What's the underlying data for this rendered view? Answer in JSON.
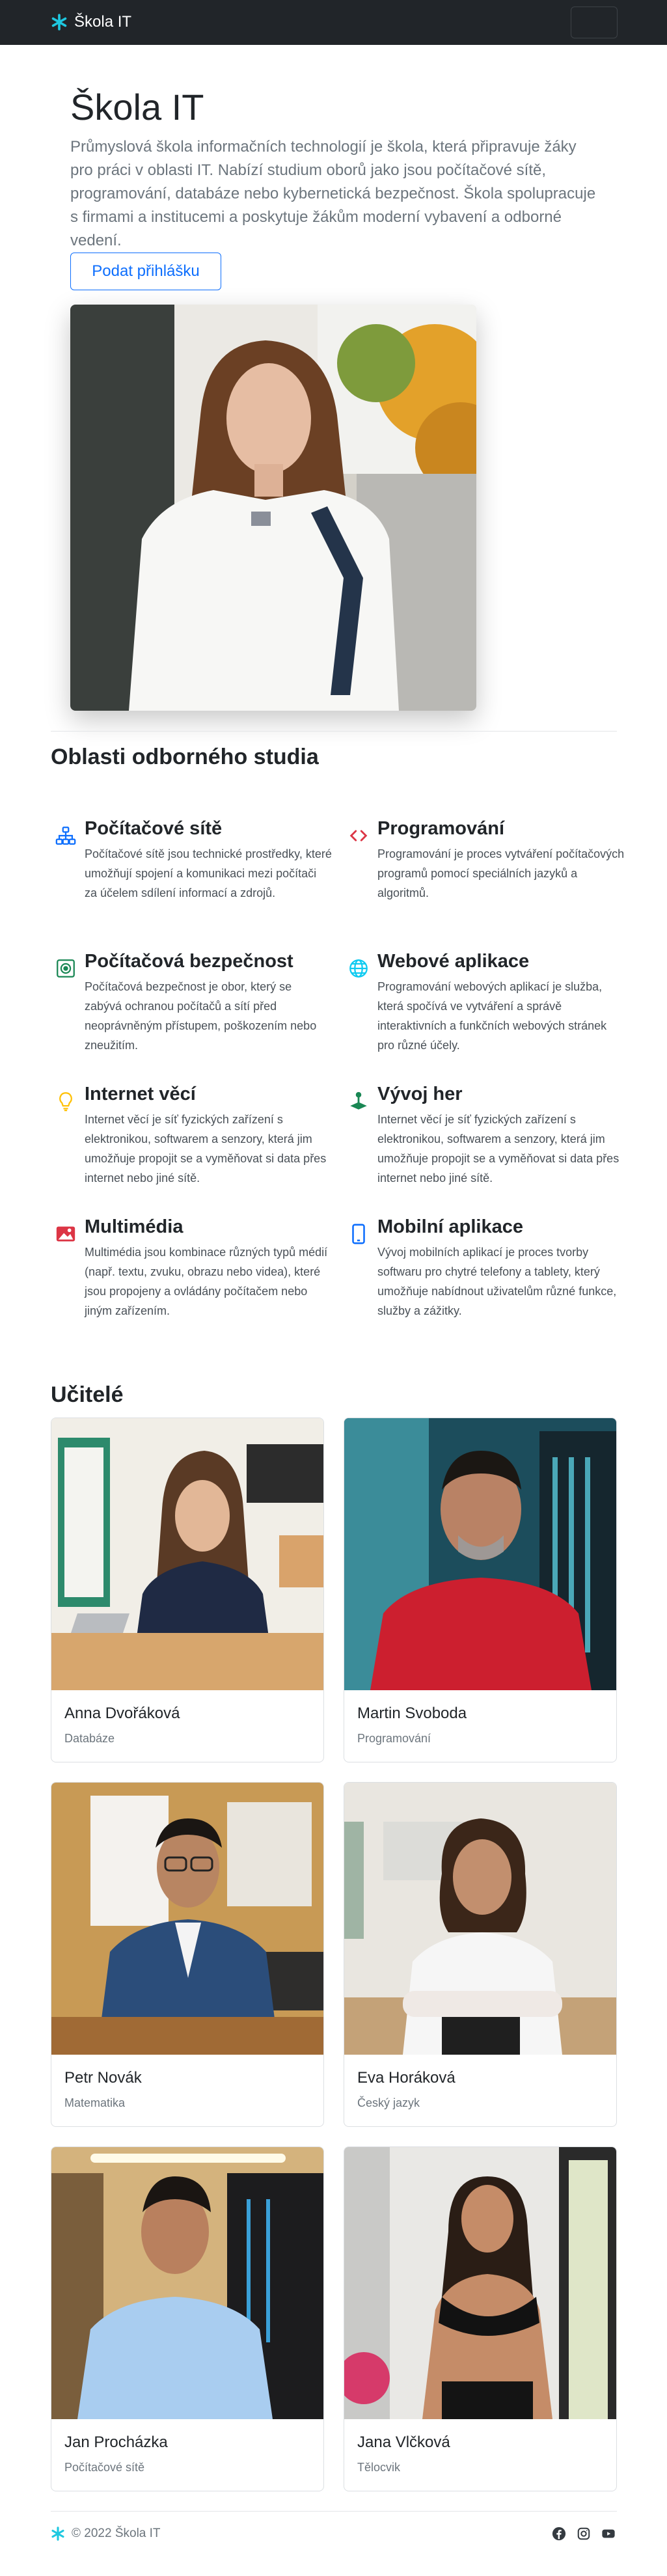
{
  "navbar": {
    "brand": "Škola IT",
    "brand_icon": "asterisk-icon",
    "toggler_icon": "menu-toggle"
  },
  "hero": {
    "title": "Škola IT",
    "lead": "Průmyslová škola informačních technologií je škola, která připravuje žáky pro práci v oblasti IT. Nabízí studium oborů jako jsou počítačové sítě, programování, databáze nebo kybernetická bezpečnost. Škola spolupracuje s firmami a institucemi a poskytuje žákům moderní vybavení a odborné vedení.",
    "button": "Podat přihlášku"
  },
  "features_title": "Oblasti odborného studia",
  "features": [
    {
      "title": "Počítačové sítě",
      "icon": "network-icon",
      "text": "Počítačové sítě jsou technické prostředky, které umožňují spojení a komunikaci mezi počítači za účelem sdílení informací a zdrojů."
    },
    {
      "title": "Programování",
      "icon": "code-icon",
      "text": "Programování je proces vytváření počítačových programů pomocí speciálních jazyků a algoritmů."
    },
    {
      "title": "Počítačová bezpečnost",
      "icon": "shield-icon",
      "text": "Počítačová bezpečnost je obor, který se zabývá ochranou počítačů a sítí před neoprávněným přístupem, poškozením nebo zneužitím."
    },
    {
      "title": "Webové aplikace",
      "icon": "globe-icon",
      "text": "Programování webových aplikací je služba, která spočívá ve vytváření a správě interaktivních a funkčních webových stránek pro různé účely."
    },
    {
      "title": "Internet věcí",
      "icon": "lightbulb-icon",
      "text": "Internet věcí je síť fyzických zařízení s elektronikou, softwarem a senzory, která jim umožňuje propojit se a vyměňovat si data přes internet nebo jiné sítě."
    },
    {
      "title": "Vývoj her",
      "icon": "controller-icon",
      "text": "Internet věcí je síť fyzických zařízení s elektronikou, softwarem a senzory, která jim umožňuje propojit se a vyměňovat si data přes internet nebo jiné sítě."
    },
    {
      "title": "Multimédia",
      "icon": "image-icon",
      "text": "Multimédia jsou kombinace různých typů médií (např. textu, zvuku, obrazu nebo videa), které jsou propojeny a ovládány počítačem nebo jiným zařízením."
    },
    {
      "title": "Mobilní aplikace",
      "icon": "phone-icon",
      "text": "Vývoj mobilních aplikací je proces tvorby softwaru pro chytré telefony a tablety, který umožňuje nabídnout uživatelům různé funkce, služby a zážitky."
    }
  ],
  "teachers_title": "Učitelé",
  "teachers": [
    {
      "name": "Anna Dvořáková",
      "subject": "Databáze"
    },
    {
      "name": "Martin Svoboda",
      "subject": "Programování"
    },
    {
      "name": "Petr Novák",
      "subject": "Matematika"
    },
    {
      "name": "Eva Horáková",
      "subject": "Český jazyk"
    },
    {
      "name": "Jan Procházka",
      "subject": "Počítačové sítě"
    },
    {
      "name": "Jana Vlčková",
      "subject": "Tělocvik"
    }
  ],
  "footer": {
    "copyright": "© 2022 Škola IT",
    "social": [
      "facebook-icon",
      "instagram-icon",
      "youtube-icon"
    ]
  },
  "colors": {
    "primary": "#0d6efd",
    "navbar": "#212529",
    "brand_accent": "#1ec8e0",
    "muted": "#6c757d"
  }
}
